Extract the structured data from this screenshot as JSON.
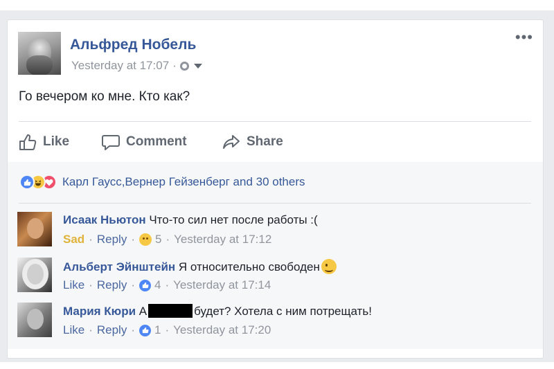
{
  "post": {
    "author": "Альфред Нобель",
    "time": "Yesterday at 17:07",
    "separator": "·",
    "privacy_icon": "globe-icon",
    "menu": "•••",
    "text": "Го вечером ко мне. Кто как?"
  },
  "actions": {
    "like": "Like",
    "comment": "Comment",
    "share": "Share"
  },
  "reactions": {
    "icons": [
      "like-icon",
      "haha-icon",
      "love-icon"
    ],
    "summary": "Карл Гаусс,Вернер Гейзенберг and 30 others",
    "colors": {
      "like": "#4e87f5",
      "haha": "#f7c843",
      "love": "#f0506b"
    }
  },
  "comments": [
    {
      "author": "Исаак Ньютон",
      "text": "Что-то сил нет после работы :(",
      "reaction_label": "Sad",
      "reply": "Reply",
      "reaction_icon": "sad-icon",
      "count": "5",
      "time": "Yesterday at 17:12"
    },
    {
      "author": "Альберт Эйнштейн",
      "text": "Я относительно свободен",
      "emoji": "wink-emoji",
      "reaction_label": "Like",
      "reply": "Reply",
      "reaction_icon": "like-icon",
      "count": "4",
      "time": "Yesterday at 17:14"
    },
    {
      "author": "Мария Кюри",
      "text_before": "А",
      "text_after": "будет? Хотела с ним потрещать!",
      "reaction_label": "Like",
      "reply": "Reply",
      "reaction_icon": "like-icon",
      "count": "1",
      "time": "Yesterday at 17:20"
    }
  ],
  "colors": {
    "link": "#365899",
    "meta": "#90949c",
    "sad": "#e0b33a",
    "background": "#e9ebee"
  }
}
